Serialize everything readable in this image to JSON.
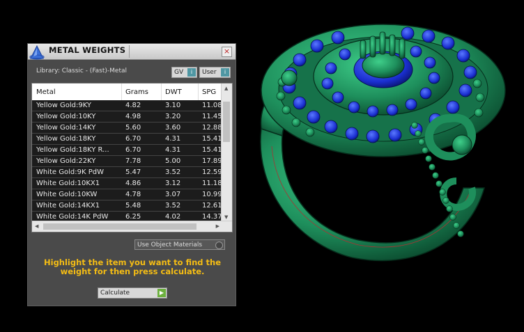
{
  "panel": {
    "title": "METAL WEIGHTS",
    "library_label": "Library: Classic - (Fast)-Metal",
    "toggles": [
      {
        "label": "GV",
        "indicator": "i"
      },
      {
        "label": "User",
        "indicator": "i"
      }
    ],
    "close_glyph": "×"
  },
  "table": {
    "columns": [
      "Metal",
      "Grams",
      "DWT",
      "SPG"
    ],
    "rows": [
      [
        "Yellow Gold:9KY",
        "4.82",
        "3.10",
        "11.08"
      ],
      [
        "Yellow Gold:10KY",
        "4.98",
        "3.20",
        "11.45"
      ],
      [
        "Yellow Gold:14KY",
        "5.60",
        "3.60",
        "12.88"
      ],
      [
        "Yellow Gold:18KY",
        "6.70",
        "4.31",
        "15.41"
      ],
      [
        "Yellow Gold:18KY R...",
        "6.70",
        "4.31",
        "15.41"
      ],
      [
        "Yellow Gold:22KY",
        "7.78",
        "5.00",
        "17.89"
      ],
      [
        "White Gold:9K PdW",
        "5.47",
        "3.52",
        "12.59"
      ],
      [
        "White Gold:10KX1",
        "4.86",
        "3.12",
        "11.18"
      ],
      [
        "White Gold:10KW",
        "4.78",
        "3.07",
        "10.99"
      ],
      [
        "White Gold:14KX1",
        "5.48",
        "3.52",
        "12.61"
      ],
      [
        "White Gold:14K PdW",
        "6.25",
        "4.02",
        "14.37"
      ]
    ]
  },
  "use_object_materials": {
    "label": "Use Object Materials"
  },
  "instruction": "Highlight the item you want to find the weight for then press calculate.",
  "calculate": {
    "label": "Calculate",
    "indicator": "▶"
  },
  "colors": {
    "instruction_text": "#f5bd14",
    "ring_metal": "#1e8f5c",
    "stones": "#1a2fd0",
    "calc_indicator": "#6cb03e",
    "toggle_indicator": "#4f97a3"
  },
  "viewport": {
    "icon": "ring-3d-model"
  }
}
